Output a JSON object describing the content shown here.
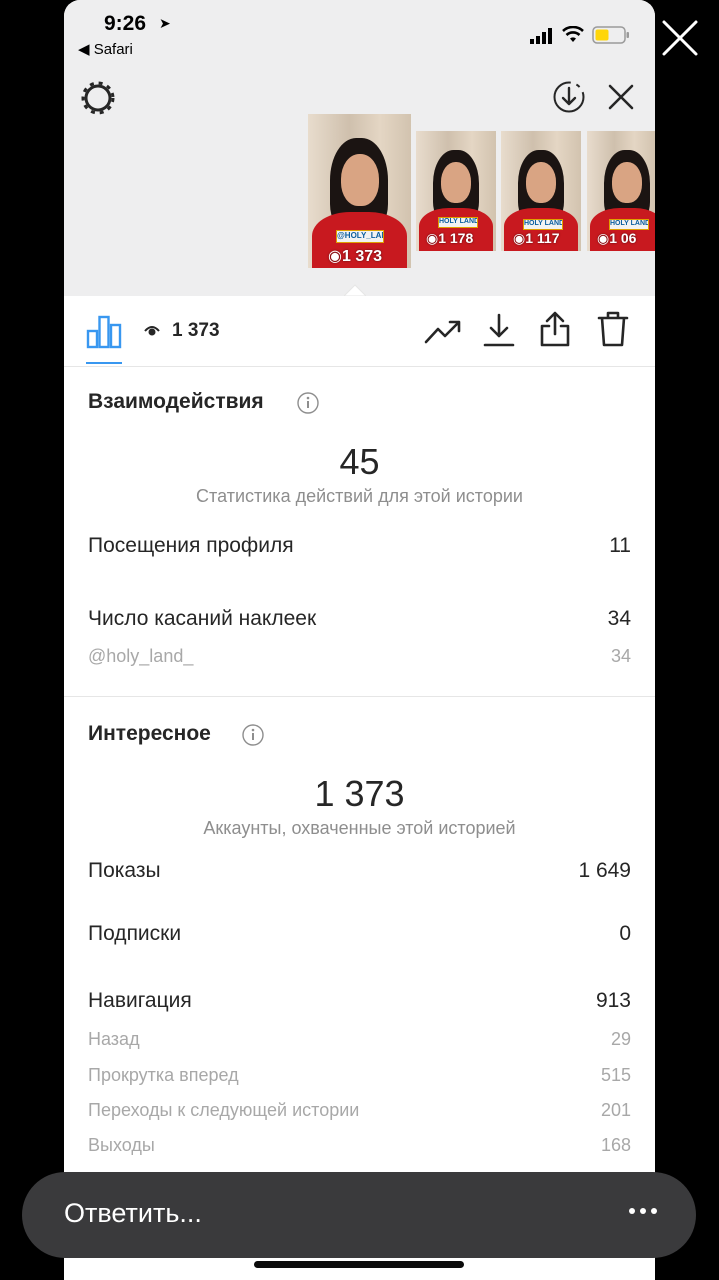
{
  "status_bar": {
    "time": "9:26",
    "location_arrow": "➤",
    "back_app": "◀ Safari"
  },
  "icons": {
    "outer_close": "close-icon",
    "settings": "gear-icon",
    "download_circle": "download-circle-icon",
    "close": "close-icon",
    "insights": "bar-chart-icon",
    "views": "eye-icon",
    "promote": "trending-up-icon",
    "save": "download-icon",
    "share": "share-icon",
    "delete": "trash-icon",
    "info": "info-icon",
    "more": "more-horizontal-icon"
  },
  "thumbnails": [
    {
      "sticker": "@HOLY_LAND",
      "views": "1 373",
      "selected": true
    },
    {
      "sticker": "HOLY LAND",
      "views": "1 178",
      "selected": false
    },
    {
      "sticker": "HOLY LAND",
      "views": "1 117",
      "selected": false
    },
    {
      "sticker": "HOLY LAND",
      "views": "1 06",
      "selected": false
    }
  ],
  "action_bar": {
    "viewer_count": "1 373"
  },
  "interactions": {
    "title": "Взаимодействия",
    "total": "45",
    "caption": "Статистика действий для этой истории",
    "rows": [
      {
        "label": "Посещения профиля",
        "value": "11"
      },
      {
        "label": "Число касаний наклеек",
        "value": "34"
      }
    ],
    "sub_rows": [
      {
        "label": "@holy_land_",
        "value": "34"
      }
    ]
  },
  "discovery": {
    "title": "Интересное",
    "total": "1 373",
    "caption": "Аккаунты, охваченные этой историей",
    "rows": [
      {
        "label": "Показы",
        "value": "1 649"
      },
      {
        "label": "Подписки",
        "value": "0"
      },
      {
        "label": "Навигация",
        "value": "913"
      }
    ],
    "sub_rows": [
      {
        "label": "Назад",
        "value": "29"
      },
      {
        "label": "Прокрутка вперед",
        "value": "515"
      },
      {
        "label": "Переходы к следующей истории",
        "value": "201"
      },
      {
        "label": "Выходы",
        "value": "168"
      }
    ]
  },
  "reply": {
    "placeholder": "Ответить..."
  },
  "colors": {
    "accent": "#3897f0",
    "text": "#262626",
    "muted": "#8e8e8e",
    "battery": "#ffd60a"
  }
}
